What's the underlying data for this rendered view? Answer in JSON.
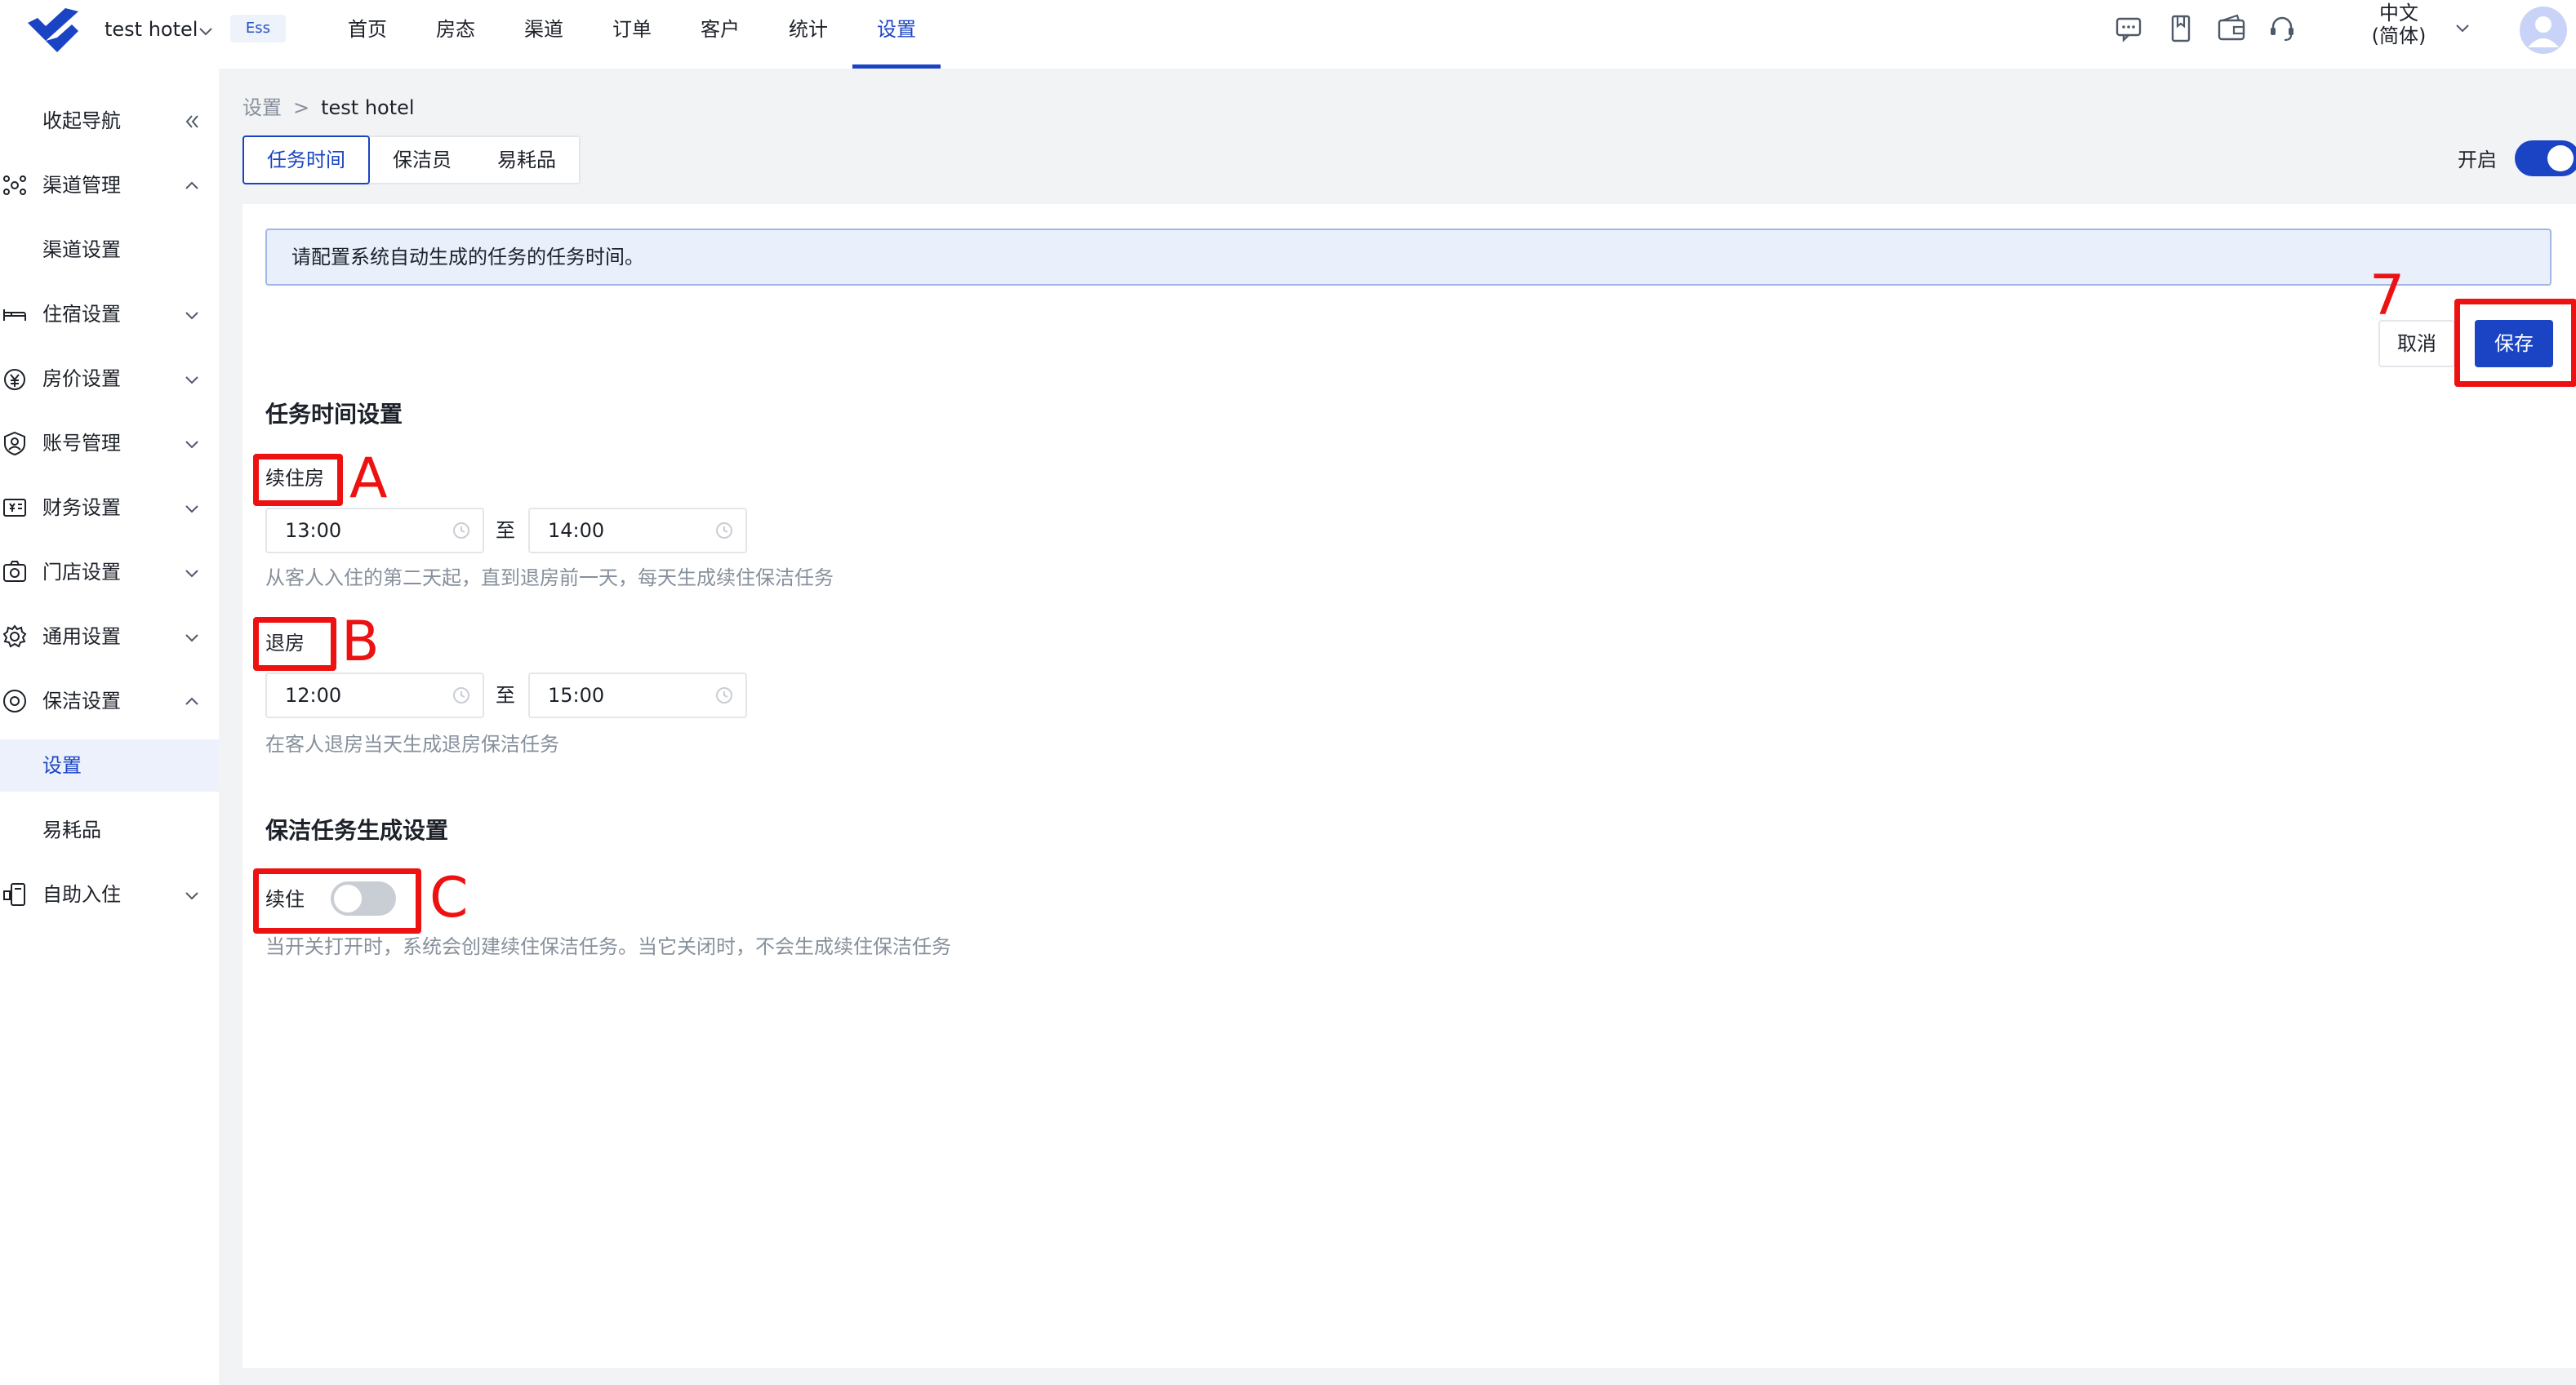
{
  "header": {
    "hotel_name": "test hotel",
    "badge": "Ess",
    "nav": [
      "首页",
      "房态",
      "渠道",
      "订单",
      "客户",
      "统计",
      "设置"
    ],
    "active_nav": "设置",
    "language_line1": "中文",
    "language_line2": "(简体)",
    "icons": [
      "message-icon",
      "book-icon",
      "wallet-icon",
      "headset-icon"
    ]
  },
  "sidebar": {
    "collapse_label": "收起导航",
    "items": [
      {
        "label": "渠道管理",
        "icon": "channel-icon",
        "expanded": true
      },
      {
        "label": "渠道设置"
      },
      {
        "label": "住宿设置",
        "icon": "bed-icon"
      },
      {
        "label": "房价设置",
        "icon": "price-icon"
      },
      {
        "label": "账号管理",
        "icon": "account-icon"
      },
      {
        "label": "财务设置",
        "icon": "finance-icon"
      },
      {
        "label": "门店设置",
        "icon": "store-icon"
      },
      {
        "label": "通用设置",
        "icon": "gear-icon"
      },
      {
        "label": "保洁设置",
        "icon": "cleaning-icon",
        "expanded": true
      },
      {
        "label": "设置",
        "active": true
      },
      {
        "label": "易耗品"
      },
      {
        "label": "自助入住",
        "icon": "self-checkin-icon"
      }
    ]
  },
  "breadcrumb": {
    "root": "设置",
    "current": "test hotel"
  },
  "tabs": [
    "任务时间",
    "保洁员",
    "易耗品"
  ],
  "open_toggle": {
    "label": "开启",
    "on": true
  },
  "alert_text": "请配置系统自动生成的任务的任务时间。",
  "buttons": {
    "cancel": "取消",
    "save": "保存"
  },
  "task_time": {
    "title": "任务时间设置",
    "stayover": {
      "label": "续住房",
      "from": "13:00",
      "to": "14:00",
      "hint": "从客人入住的第二天起，直到退房前一天，每天生成续住保洁任务"
    },
    "checkout": {
      "label": "退房",
      "from": "12:00",
      "to": "15:00",
      "hint": "在客人退房当天生成退房保洁任务"
    },
    "range_sep": "至"
  },
  "generation": {
    "title": "保洁任务生成设置",
    "label": "续住",
    "on": false,
    "hint": "当开关打开时，系统会创建续住保洁任务。当它关闭时，不会生成续住保洁任务"
  },
  "annotations": [
    "7",
    "A",
    "B",
    "C"
  ],
  "colors": {
    "primary": "#1a44c4",
    "annotation": "#ee1111"
  }
}
